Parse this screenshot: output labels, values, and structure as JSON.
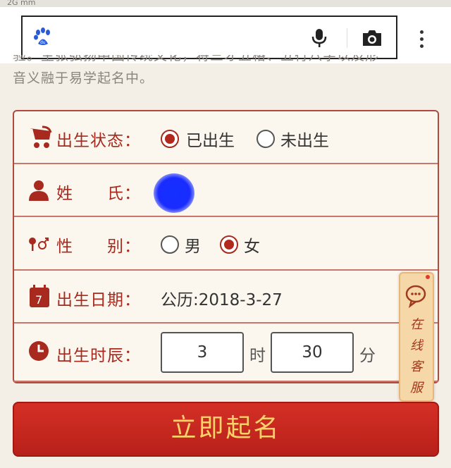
{
  "status_bar": {
    "network": "2G mm"
  },
  "browser": {
    "search_placeholder": "",
    "icons": {
      "logo": "baidu-paw-icon",
      "mic": "microphone-icon",
      "camera": "camera-icon",
      "menu": "more-vertical-icon"
    }
  },
  "intro": {
    "line1": "验。主张弘扬中国传统文化，将三才五格、五行八字以及形",
    "line2": "音义融于易学起名中。"
  },
  "form": {
    "birth_status": {
      "label": "出生状态：",
      "options": [
        "已出生",
        "未出生"
      ],
      "selected": "已出生"
    },
    "surname": {
      "label": "姓　　氏：",
      "value_redacted": true
    },
    "gender": {
      "label": "性　　别：",
      "options": [
        "男",
        "女"
      ],
      "selected": "女"
    },
    "birth_date": {
      "label": "出生日期：",
      "value": "公历:2018-3-27"
    },
    "birth_time": {
      "label": "出生时辰：",
      "hour": "3",
      "hour_unit": "时",
      "minute": "30",
      "minute_unit": "分"
    }
  },
  "service": {
    "label": "在线客服"
  },
  "cta": {
    "label": "立即起名"
  },
  "colors": {
    "accent": "#b2281c",
    "cta_text": "#fbd26a",
    "panel_bg": "#fbf7ee"
  }
}
